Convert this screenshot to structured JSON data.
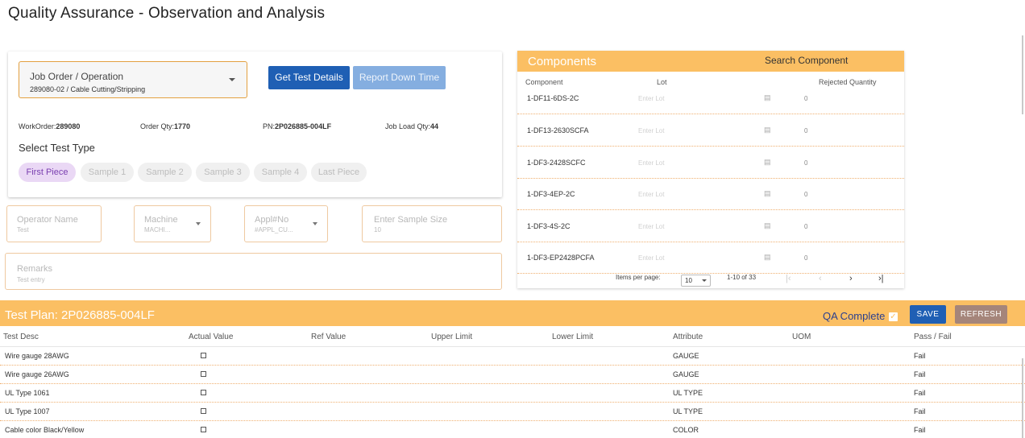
{
  "page": {
    "title": "Quality Assurance - Observation and Analysis"
  },
  "job": {
    "label": "Job Order / Operation",
    "value": "289080-02 / Cable Cutting/Stripping",
    "get_test_details": "Get Test Details",
    "report_down_time": "Report Down Time"
  },
  "info": {
    "workorder_label": "WorkOrder:",
    "workorder_value": "289080",
    "order_qty_label": "Order Qty:",
    "order_qty_value": "1770",
    "pn_label": "PN:",
    "pn_value": "2P026885-004LF",
    "job_load_label": "Job Load Qty:",
    "job_load_value": "44"
  },
  "test_type": {
    "heading": "Select Test Type",
    "chips": [
      "First Piece",
      "Sample 1",
      "Sample 2",
      "Sample 3",
      "Sample 4",
      "Last Piece"
    ],
    "active": "First Piece"
  },
  "fields": {
    "operator": {
      "label": "Operator Name",
      "value": "Test"
    },
    "machine": {
      "label": "Machine",
      "value": "MACHI..."
    },
    "appl": {
      "label": "Appl#No",
      "value": "#APPL_CU..."
    },
    "sample_size": {
      "label": "Enter Sample Size",
      "value": "10"
    },
    "remarks": {
      "label": "Remarks",
      "value": "Test entry"
    }
  },
  "components": {
    "title": "Components",
    "search": "Search Component",
    "columns": {
      "component": "Component",
      "lot": "Lot",
      "rejected": "Rejected Quantity"
    },
    "rows": [
      {
        "name": "1-DF11-6DS-2C",
        "lot": "Enter Lot",
        "rejected": "0"
      },
      {
        "name": "1-DF13-2630SCFA",
        "lot": "Enter Lot",
        "rejected": "0"
      },
      {
        "name": "1-DF3-2428SCFC",
        "lot": "Enter Lot",
        "rejected": "0"
      },
      {
        "name": "1-DF3-4EP-2C",
        "lot": "Enter Lot",
        "rejected": "0"
      },
      {
        "name": "1-DF3-4S-2C",
        "lot": "Enter Lot",
        "rejected": "0"
      },
      {
        "name": "1-DF3-EP2428PCFA",
        "lot": "Enter Lot",
        "rejected": "0"
      }
    ],
    "pager": {
      "items_per_page_label": "Items per page:",
      "items_per_page": "10",
      "range": "1-10 of 33"
    }
  },
  "test_plan": {
    "title": "Test Plan: 2P026885-004LF",
    "qa_complete": "QA Complete",
    "qa_checked": true,
    "save": "SAVE",
    "refresh": "REFRESH",
    "columns": {
      "desc": "Test Desc",
      "actual": "Actual Value",
      "ref": "Ref Value",
      "upper": "Upper Limit",
      "lower": "Lower Limit",
      "attribute": "Attribute",
      "uom": "UOM",
      "pass": "Pass / Fail"
    },
    "rows": [
      {
        "desc": "Wire gauge 28AWG",
        "attribute": "GAUGE",
        "result": "Fail"
      },
      {
        "desc": "Wire gauge 26AWG",
        "attribute": "GAUGE",
        "result": "Fail"
      },
      {
        "desc": "UL Type 1061",
        "attribute": "UL TYPE",
        "result": "Fail"
      },
      {
        "desc": "UL Type 1007",
        "attribute": "UL TYPE",
        "result": "Fail"
      },
      {
        "desc": "Cable color Black/Yellow",
        "attribute": "COLOR",
        "result": "Fail"
      }
    ]
  },
  "colors": {
    "accent": "#fbbf63",
    "primary": "#1f5fb4",
    "chip_active": "#ead8f5"
  },
  "icons": {
    "scan": "barcode-scan-icon"
  }
}
